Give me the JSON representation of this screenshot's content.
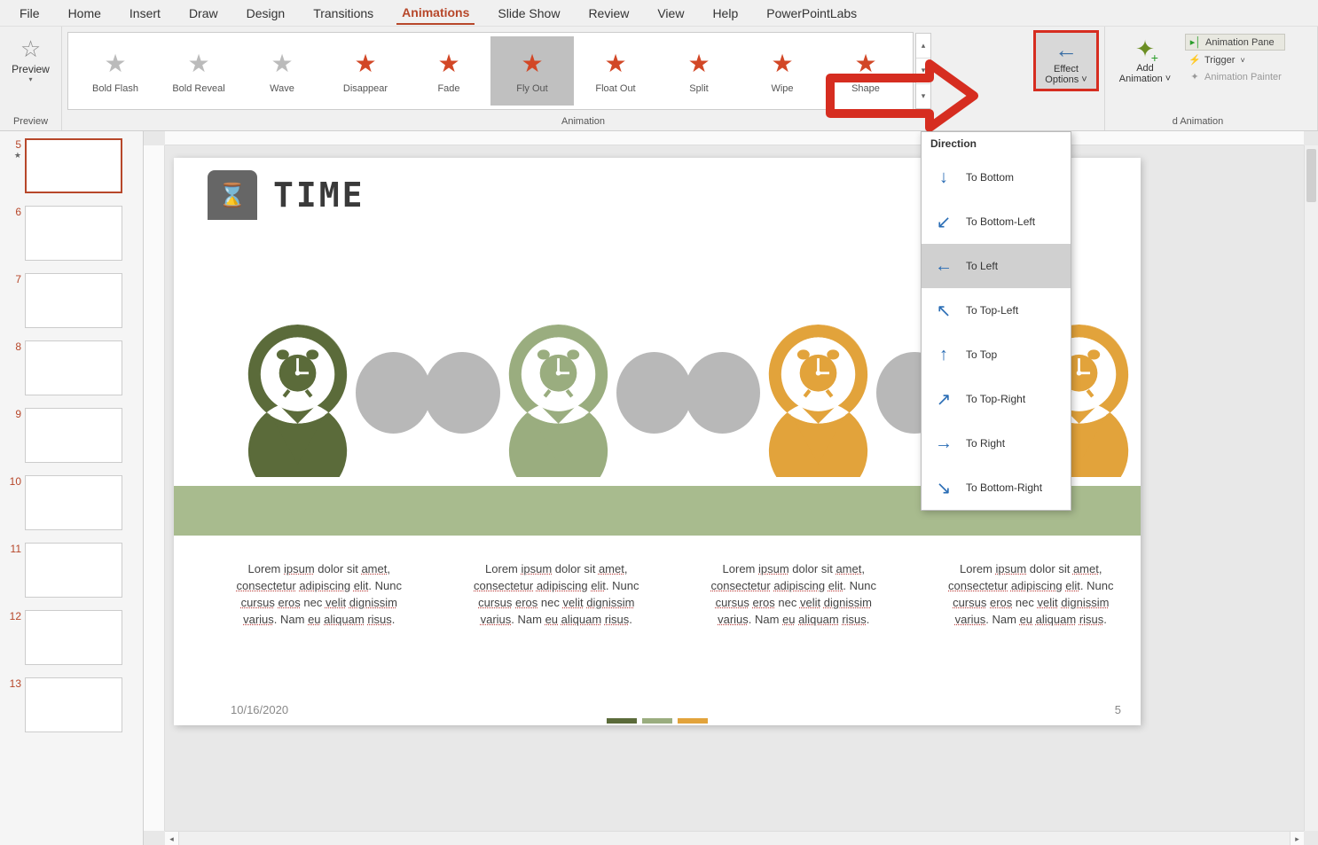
{
  "menu": {
    "tabs": [
      "File",
      "Home",
      "Insert",
      "Draw",
      "Design",
      "Transitions",
      "Animations",
      "Slide Show",
      "Review",
      "View",
      "Help",
      "PowerPointLabs"
    ],
    "active": "Animations"
  },
  "ribbon": {
    "preview": {
      "label": "Preview",
      "group_label": "Preview"
    },
    "animation_group_label": "Animation",
    "gallery": [
      {
        "label": "Bold Flash",
        "style": "gray"
      },
      {
        "label": "Bold Reveal",
        "style": "gray"
      },
      {
        "label": "Wave",
        "style": "gray"
      },
      {
        "label": "Disappear",
        "style": "red"
      },
      {
        "label": "Fade",
        "style": "red"
      },
      {
        "label": "Fly Out",
        "style": "red",
        "selected": true
      },
      {
        "label": "Float Out",
        "style": "red"
      },
      {
        "label": "Split",
        "style": "red"
      },
      {
        "label": "Wipe",
        "style": "red"
      },
      {
        "label": "Shape",
        "style": "red"
      }
    ],
    "effect_options_label": "Effect\nOptions",
    "add_animation_label": "Add\nAnimation",
    "adv_group_label": "Advanced Animation",
    "adv_rows": {
      "animation_pane": "Animation Pane",
      "trigger": "Trigger",
      "animation_painter": "Animation Painter"
    }
  },
  "direction_menu": {
    "header": "Direction",
    "items": [
      {
        "label": "To Bottom",
        "glyph": "↓"
      },
      {
        "label": "To Bottom-Left",
        "glyph": "↙"
      },
      {
        "label": "To Left",
        "glyph": "←",
        "selected": true
      },
      {
        "label": "To Top-Left",
        "glyph": "↖"
      },
      {
        "label": "To Top",
        "glyph": "↑"
      },
      {
        "label": "To Top-Right",
        "glyph": "↗"
      },
      {
        "label": "To Right",
        "glyph": "→"
      },
      {
        "label": "To Bottom-Right",
        "glyph": "↘"
      }
    ]
  },
  "thumbnails": {
    "start_index": 5,
    "count": 9
  },
  "slide": {
    "title": "TIME",
    "lorem": "Lorem ipsum dolor sit amet, consectetur adipiscing elit. Nunc cursus eros nec velit dignissim varius. Nam eu aliquam risus.",
    "date": "10/16/2020",
    "page": "5",
    "pin_colors": [
      "#5b6b3a",
      "#9aad7f",
      "#e2a33b",
      "#e2a33b"
    ],
    "dot_colors": [
      "#5b6b3a",
      "#9aad7f",
      "#e2a33b"
    ]
  }
}
